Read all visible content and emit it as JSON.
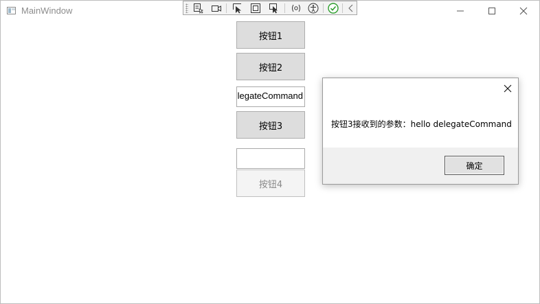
{
  "window": {
    "title": "MainWindow",
    "minimize_glyph": "—",
    "maximize_glyph": "☐",
    "close_glyph": "✕"
  },
  "toolbar": {
    "icons": [
      "select-element-icon",
      "record-icon",
      "pointer-select-icon",
      "frame-icon",
      "track-focus-icon",
      "binding-failures-icon",
      "accessibility-icon",
      "ok-status-icon",
      "collapse-chevron-icon"
    ]
  },
  "main": {
    "button1": "按钮1",
    "button2": "按钮2",
    "textbox1_value": "legateCommand",
    "button3": "按钮3",
    "textbox2_value": "",
    "button4": "按钮4"
  },
  "messagebox": {
    "text": "按钮3接收到的参数：hello delegateCommand",
    "ok_label": "确定"
  },
  "colors": {
    "button_bg": "#dddddd",
    "disabled_text": "#8a8a8a",
    "ok_status": "#2e9e2e"
  }
}
